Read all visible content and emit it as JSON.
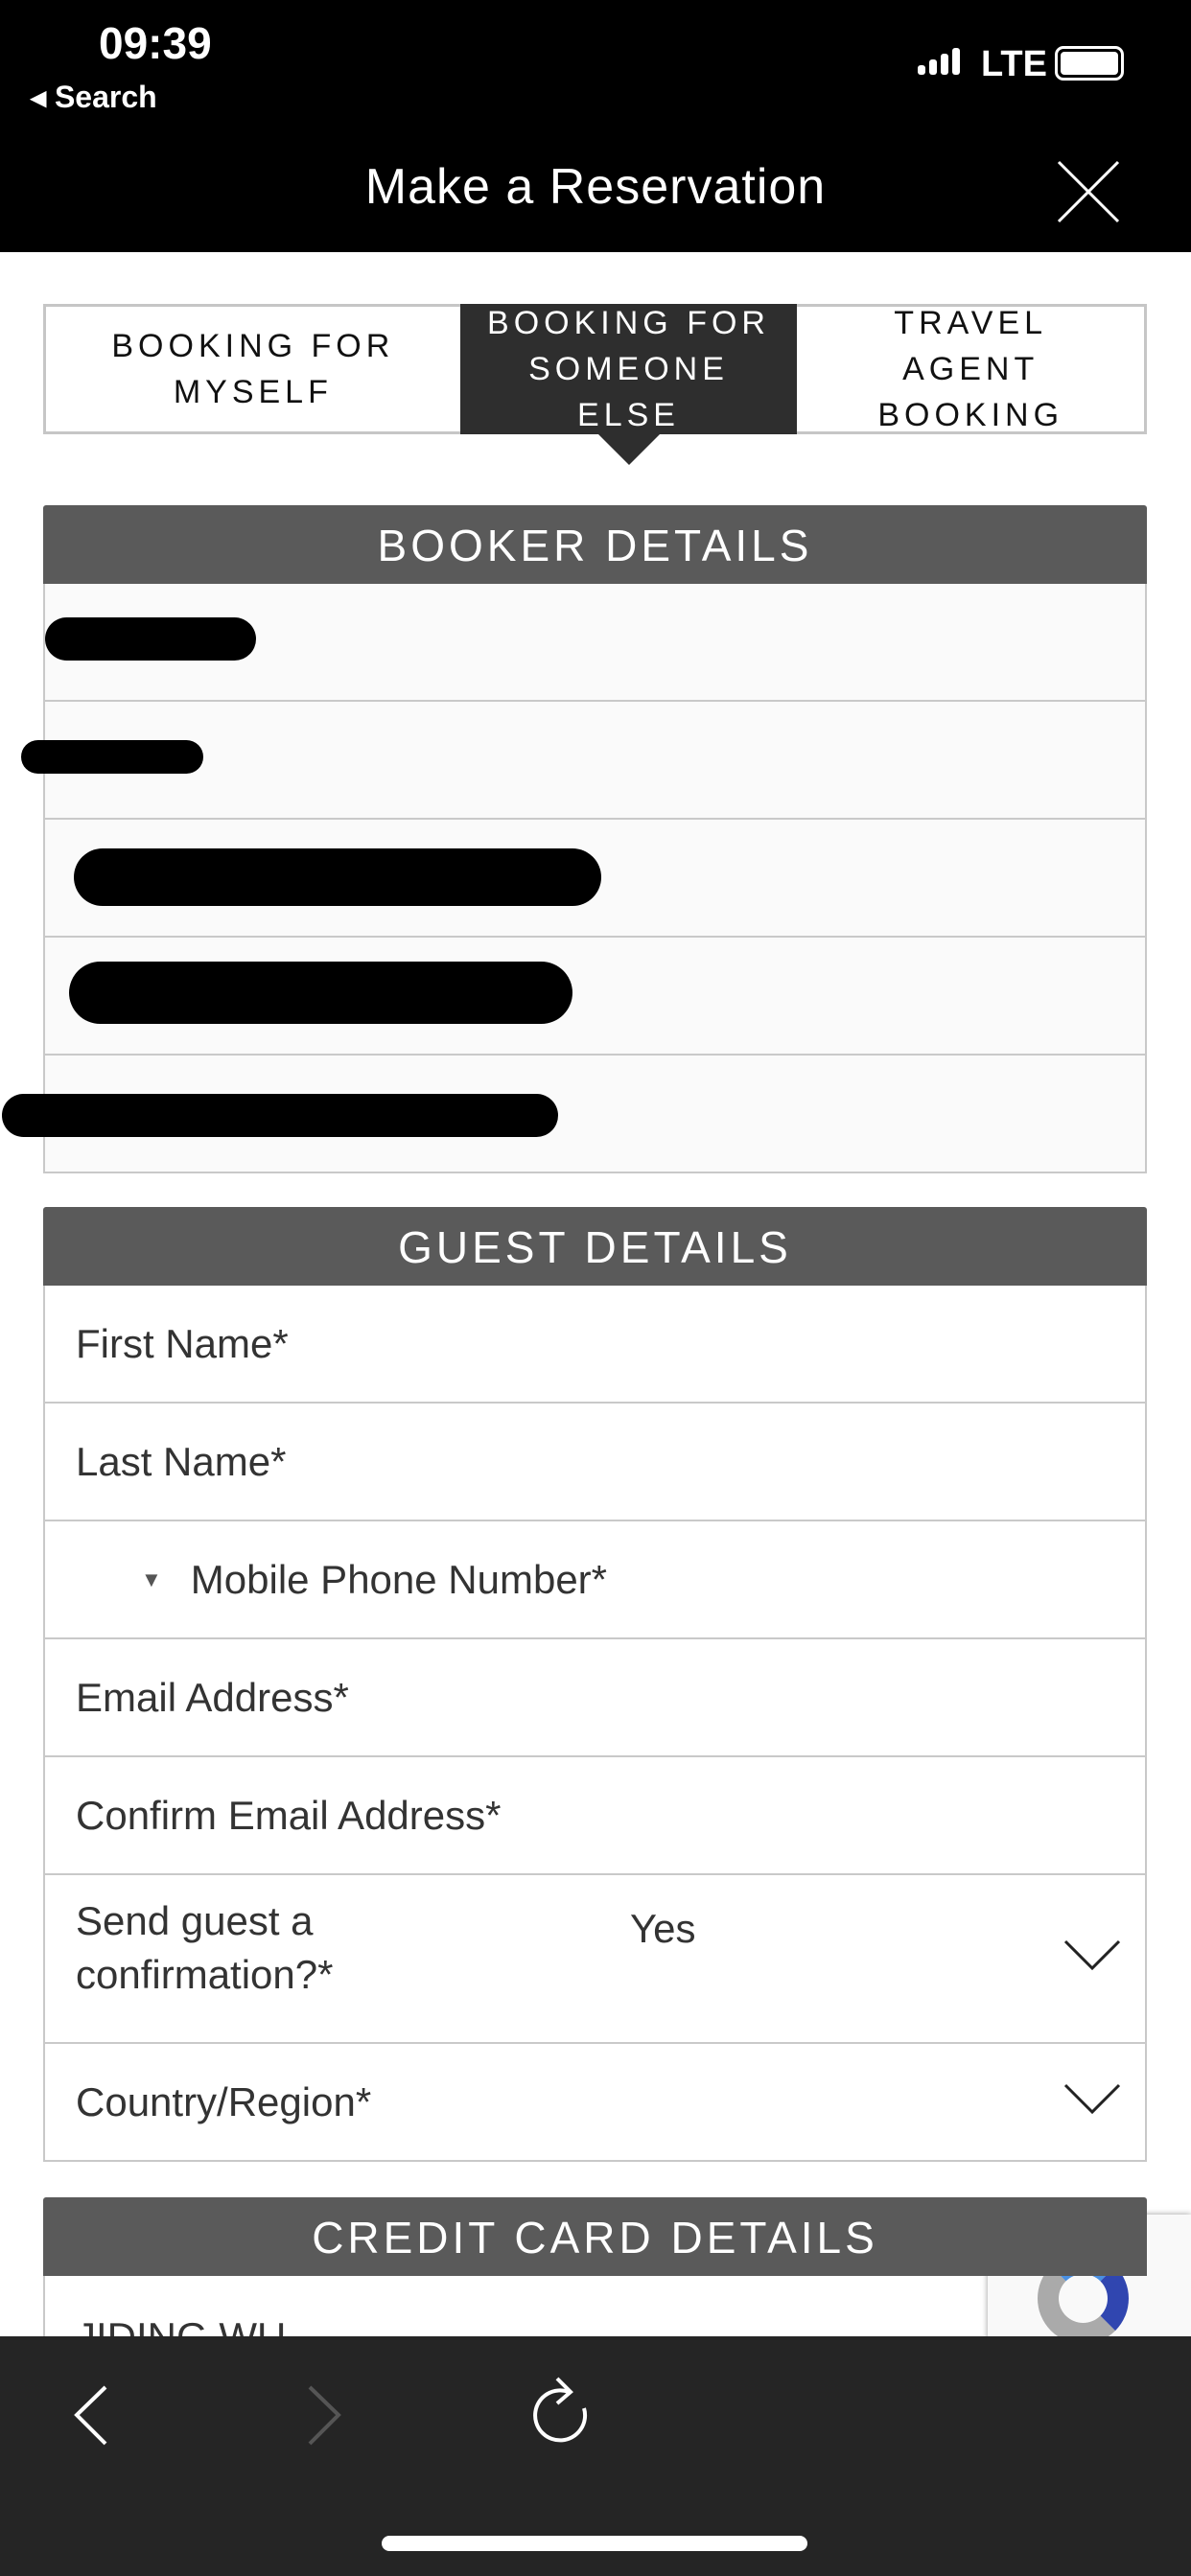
{
  "status_bar": {
    "time": "09:39",
    "back_label": "Search",
    "network": "LTE",
    "battery_level": 1.0
  },
  "header": {
    "title": "Make a Reservation",
    "close_icon": "close-icon"
  },
  "tabs": [
    {
      "label": "BOOKING FOR MYSELF",
      "active": false
    },
    {
      "label": "BOOKING FOR SOMEONE ELSE",
      "active": true
    },
    {
      "label": "TRAVEL AGENT BOOKING",
      "active": false
    }
  ],
  "booker": {
    "title": "BOOKER DETAILS",
    "rows_redacted": 5
  },
  "guest": {
    "title": "GUEST DETAILS",
    "first_name": "First Name*",
    "last_name": "Last Name*",
    "mobile": "Mobile Phone Number*",
    "email": "Email Address*",
    "confirm_email": "Confirm Email Address*",
    "send_confirmation": {
      "label": "Send guest a confirmation?*",
      "value": "Yes"
    },
    "country": "Country/Region*"
  },
  "credit_card": {
    "title": "CREDIT CARD DETAILS",
    "name_value": "JIDING WU"
  },
  "toolbar": {
    "back_icon": "chevron-left-icon",
    "forward_icon": "chevron-right-icon",
    "reload_icon": "reload-icon"
  }
}
